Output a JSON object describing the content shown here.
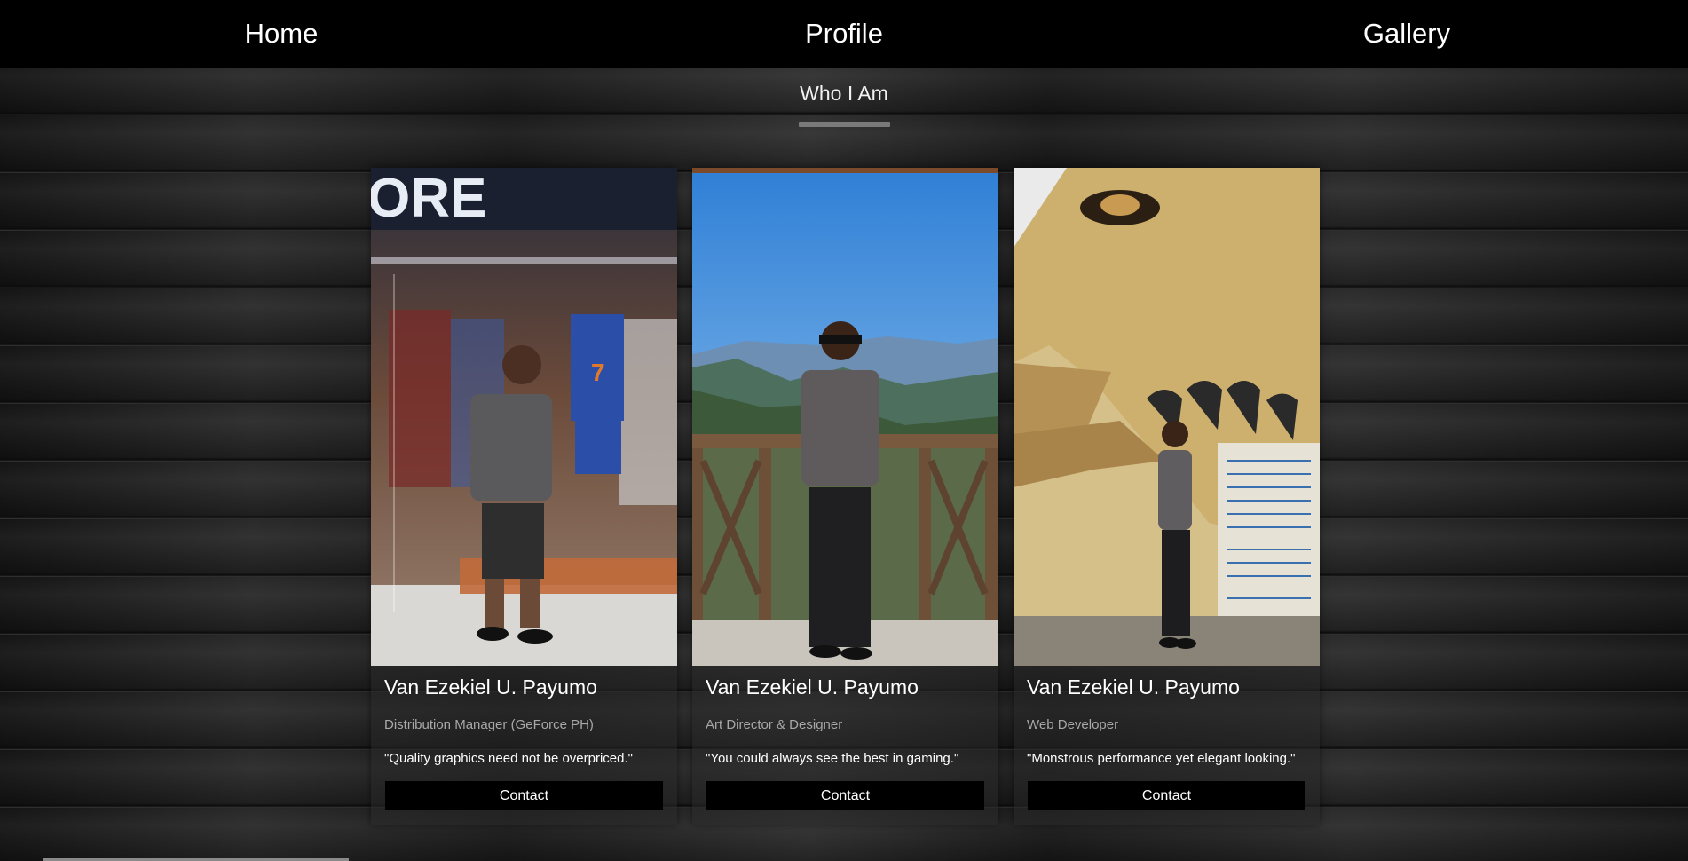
{
  "nav": {
    "items": [
      {
        "label": "Home"
      },
      {
        "label": "Profile"
      },
      {
        "label": "Gallery"
      }
    ]
  },
  "section": {
    "title": "Who I Am"
  },
  "cards": [
    {
      "name": "Van Ezekiel U. Payumo",
      "role": "Distribution Manager (GeForce PH)",
      "quote": "\"Quality graphics need not be overpriced.\"",
      "button": "Contact",
      "photo_sign_text": "ORE",
      "jersey_number": "7"
    },
    {
      "name": "Van Ezekiel U. Payumo",
      "role": "Art Director & Designer",
      "quote": "\"You could always see the best in gaming.\"",
      "button": "Contact"
    },
    {
      "name": "Van Ezekiel U. Payumo",
      "role": "Web Developer",
      "quote": "\"Monstrous performance yet elegant looking.\"",
      "button": "Contact"
    }
  ],
  "colors": {
    "navbar": "#000000",
    "button": "#000000",
    "role_text": "#a8a8a8",
    "underline": "#7a7a7a"
  }
}
